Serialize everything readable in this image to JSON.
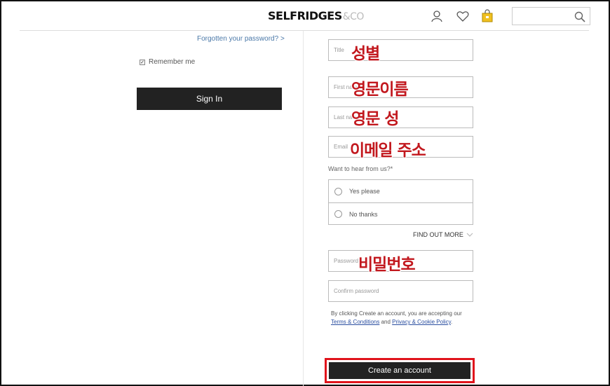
{
  "header": {
    "logo_main": "SELFRIDGES",
    "logo_suffix": "&CO",
    "icons": [
      "account-icon",
      "wishlist-heart-icon",
      "shopping-bag-icon",
      "search-icon"
    ],
    "search_placeholder": ""
  },
  "login": {
    "forgot_password": "Forgotten your password? >",
    "remember_me": "Remember me",
    "remember_checked": true,
    "sign_in": "Sign In"
  },
  "register": {
    "title_placeholder": "Title",
    "first_name_placeholder": "First name",
    "last_name_placeholder": "Last name",
    "email_placeholder": "Email",
    "hear_question": "Want to hear from us?*",
    "option_yes": "Yes please",
    "option_no": "No thanks",
    "find_out_more": "FIND OUT MORE",
    "password_placeholder": "Password",
    "confirm_password_placeholder": "Confirm password",
    "terms_prefix": "By clicking Create an account, you are accepting our ",
    "terms_link": "Terms & Conditions",
    "terms_and": " and ",
    "privacy_link": "Privacy & Cookie Policy",
    "terms_suffix": ".",
    "create_account": "Create an account"
  },
  "annotations": {
    "title": "성별",
    "first_name": "영문이름",
    "last_name": "영문 성",
    "email": "이메일 주소",
    "password": "비밀번호",
    "highlight_color": "#e0141c"
  }
}
